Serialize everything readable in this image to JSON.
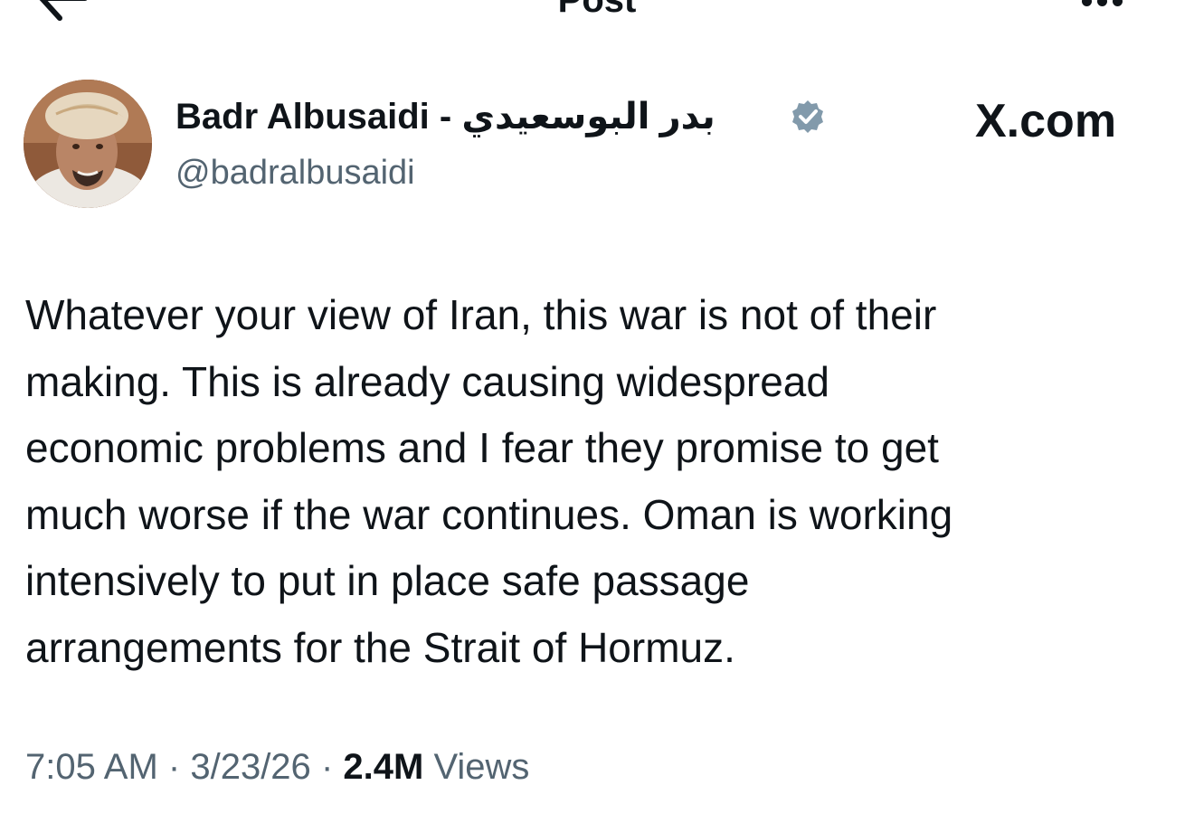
{
  "header": {
    "title": "Post",
    "back_icon": "arrow-left-icon",
    "more_icon": "more-horizontal-icon"
  },
  "author": {
    "name": "Badr Albusaidi - بدر البوسعيدي",
    "handle": "@badralbusaidi",
    "verified": true,
    "verified_badge_color": "#829aab",
    "avatar_icon": "avatar-photo"
  },
  "source_label": "X.com",
  "tweet": {
    "text": "Whatever your view of Iran, this war is not of their\nmaking. This is already causing widespread\neconomic problems and I fear they promise to get\nmuch worse if the war continues. Oman is working\nintensively to put in place safe passage\narrangements for the Strait of Hormuz."
  },
  "meta": {
    "time": "7:05 AM",
    "separator": "·",
    "date": "3/23/26",
    "views_count": "2.4M",
    "views_label": "Views"
  },
  "colors": {
    "text_primary": "#0f1419",
    "text_secondary": "#536471",
    "background": "#ffffff"
  }
}
